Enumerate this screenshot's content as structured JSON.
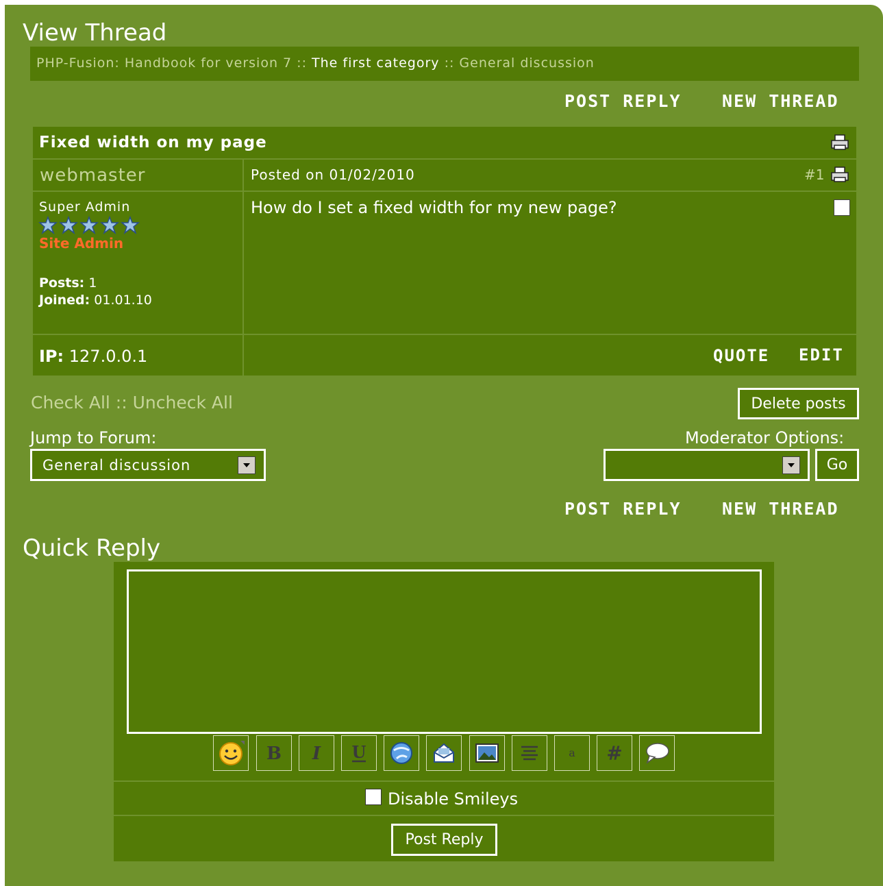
{
  "page": {
    "title": "View Thread"
  },
  "breadcrumb": {
    "site": "PHP-Fusion: Handbook for version 7",
    "sep1": " :: ",
    "category": "The first category",
    "sep2": " :: ",
    "forum": "General discussion"
  },
  "actions": {
    "post_reply": "POST REPLY",
    "new_thread": "NEW THREAD"
  },
  "thread": {
    "subject": "Fixed width on my page",
    "post": {
      "author": "webmaster",
      "posted_on": "Posted on 01/02/2010",
      "number": "#1",
      "role": "Super Admin",
      "rank_title": "Site Admin",
      "stars": 5,
      "posts_label": "Posts:",
      "posts_value": " 1",
      "joined_label": "Joined:",
      "joined_value": " 01.01.10",
      "message": "How do I set a fixed width for my new page?",
      "ip_label": "IP:",
      "ip_value": " 127.0.0.1",
      "quote": "QUOTE",
      "edit": "EDIT"
    }
  },
  "moderation": {
    "check_all": "Check All",
    "sep": " :: ",
    "uncheck_all": "Uncheck All",
    "delete_posts": "Delete posts",
    "jump_label": "Jump to Forum:",
    "jump_selected": "General discussion",
    "options_label": "Moderator Options:",
    "options_selected": "",
    "go": "Go"
  },
  "quick_reply": {
    "title": "Quick Reply",
    "message_value": "",
    "toolbar": [
      "smiley-icon",
      "bold-icon",
      "italic-icon",
      "underline-icon",
      "url-icon",
      "mail-icon",
      "image-icon",
      "center-icon",
      "small-text-icon",
      "code-icon",
      "quote-icon"
    ],
    "disable_smileys": "Disable Smileys",
    "submit": "Post Reply"
  },
  "colors": {
    "outer": "#6f922c",
    "panel": "#537b06",
    "text_light": "#c6d59a",
    "rank": "#ff6a2a",
    "star": "#9ec4e6"
  }
}
